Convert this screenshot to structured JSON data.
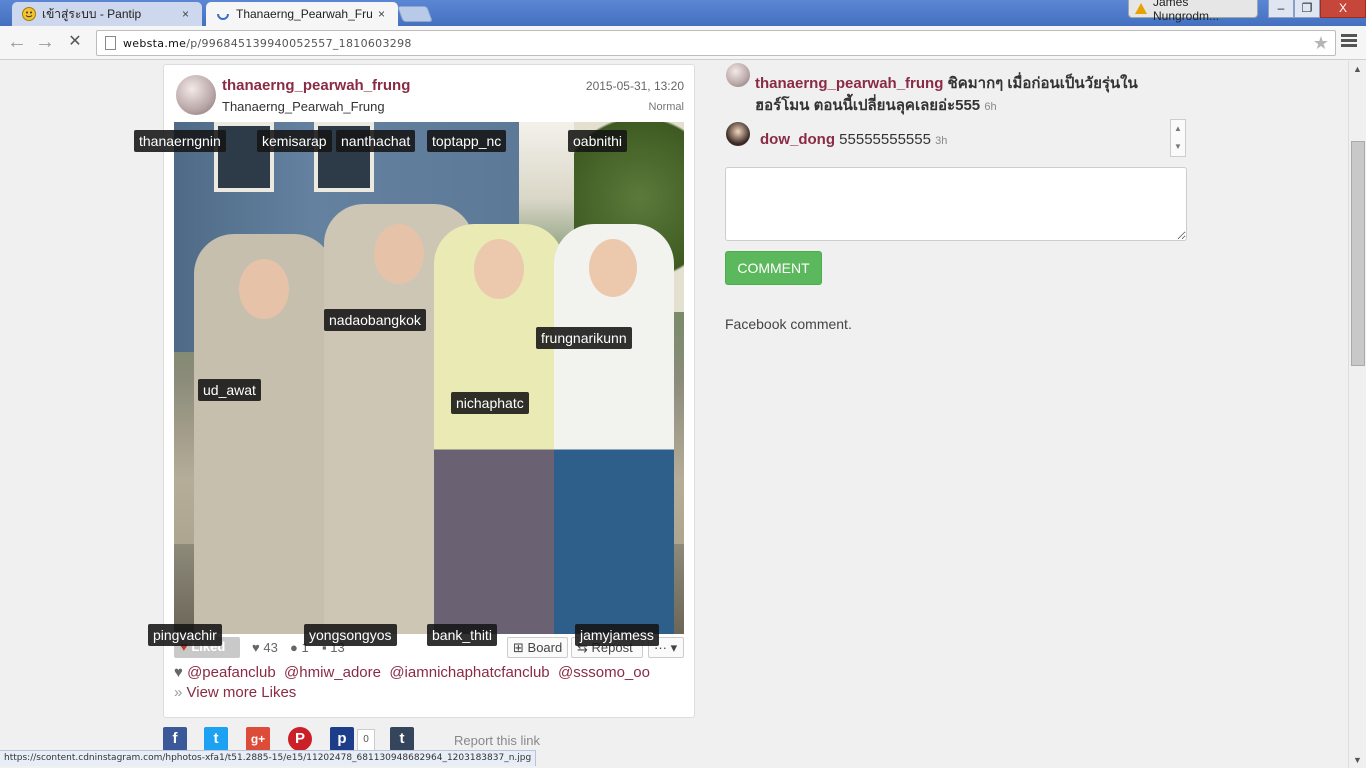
{
  "browser": {
    "tabs": [
      {
        "title": "เข้าสู่ระบบ - Pantip",
        "close": "×"
      },
      {
        "title": "Thanaerng_Pearwah_Frui",
        "close": "×"
      }
    ],
    "profile_name": "James Nungrodm...",
    "window_controls": {
      "minimize": "–",
      "maximize": "❐",
      "close": "X"
    },
    "nav": {
      "back": "←",
      "forward": "→",
      "stop": "✕"
    },
    "url_host": "websta.me",
    "url_path": "/p/996845139940052557_1810603298",
    "status_url": "https://scontent.cdninstagram.com/hphotos-xfa1/t51.2885-15/e15/11202478_681130948682964_1203183837_n.jpg"
  },
  "post": {
    "username": "thanaerng_pearwah_frung",
    "fullname": "Thanaerng_Pearwah_Frung",
    "date": "2015-05-31, 13:20",
    "filter": "Normal",
    "tags": [
      "thanaerngnin",
      "kemisarap",
      "nanthachat",
      "toptapp_nc",
      "oabnithi",
      "nadaobangkok",
      "frungnarikunn",
      "ud_awat",
      "nichaphatc",
      "pingvachir",
      "yongsongyos",
      "bank_thiti",
      "jamyjamess"
    ],
    "actions": {
      "liked_label": "Liked",
      "likes_count": "43",
      "comments_count": "1",
      "reposts_count": "13",
      "board_label": "Board",
      "repost_label": "Repost",
      "more_label": "···"
    },
    "liked_by": [
      "@peafanclub",
      "@hmiw_adore",
      "@iamnichaphatcfanclub",
      "@sssomo_oo"
    ],
    "view_more": "View more Likes",
    "share": {
      "facebook": "f",
      "twitter": "t",
      "google": "g+",
      "pinterest": "P",
      "pinterest2": "p",
      "tumblr": "t",
      "pin_count": "0"
    },
    "report": "Report this link"
  },
  "comments": {
    "main": {
      "username": "thanaerng_pearwah_frung",
      "text": "ชิคมากๆ เมื่อก่อนเป็นวัยรุ่นใน ฮอร์โมน ตอนนี้เปลี่ยนลุคเลยอ่ะ555",
      "time": "6h"
    },
    "reply": {
      "username": "dow_dong",
      "text": "55555555555",
      "time": "3h"
    },
    "button": "COMMENT",
    "facebook": "Facebook comment."
  },
  "colors": {
    "accent": "#8a2b45",
    "comment_button": "#5cb85c",
    "chrome_blue": "#4d78c6"
  }
}
